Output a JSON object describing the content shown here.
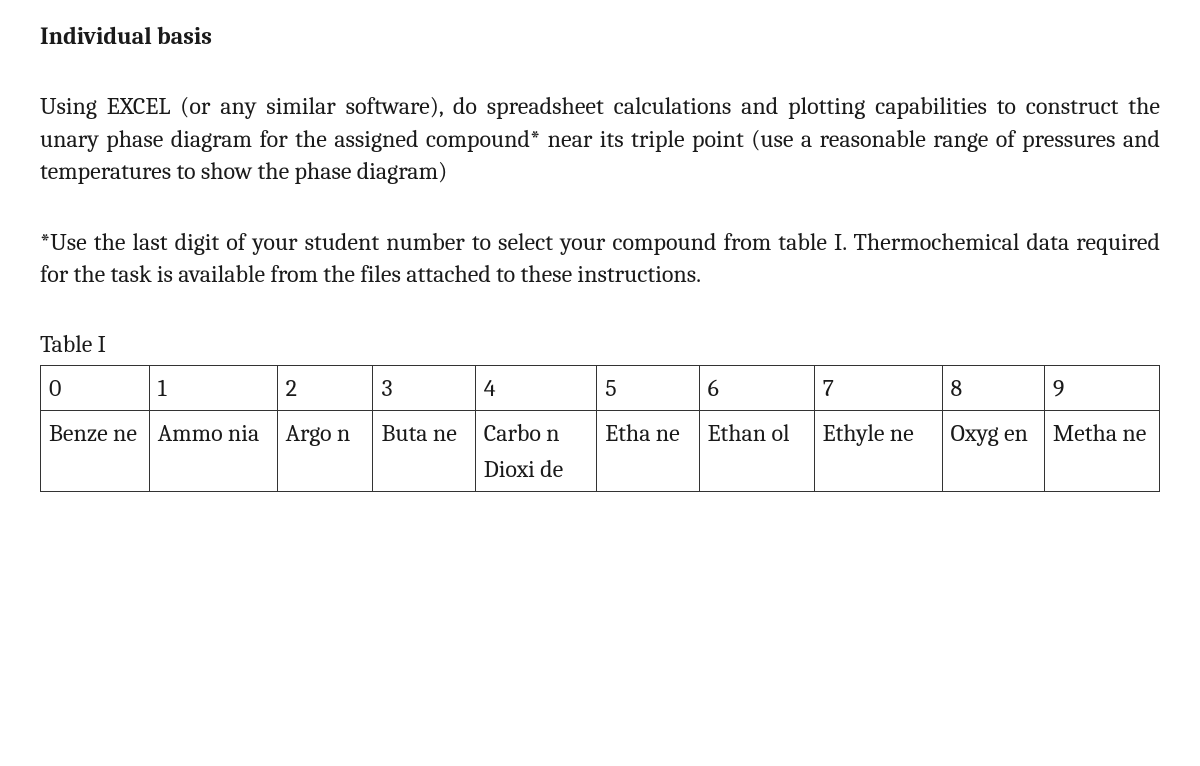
{
  "heading": "Individual basis",
  "paragraph1": "Using EXCEL (or any similar software), do spreadsheet calculations and plotting capabilities to construct the unary phase diagram for the assigned compound* near its triple point (use a reasonable range of pressures and temperatures to show the phase diagram)",
  "paragraph2": "*Use the last digit of your student number to select your compound from table I. Thermochemical data required for the task is available from the files attached to these instructions.",
  "table_caption": "Table I",
  "table": {
    "row_headers": [
      "0",
      "1",
      "2",
      "3",
      "4",
      "5",
      "6",
      "7",
      "8",
      "9"
    ],
    "row_compounds": [
      "Benze ne",
      "Ammo nia",
      "Argo n",
      "Buta ne",
      "Carbo n Dioxi de",
      "Etha ne",
      "Ethan ol",
      "Ethyle ne",
      "Oxyg en",
      "Metha ne"
    ]
  }
}
